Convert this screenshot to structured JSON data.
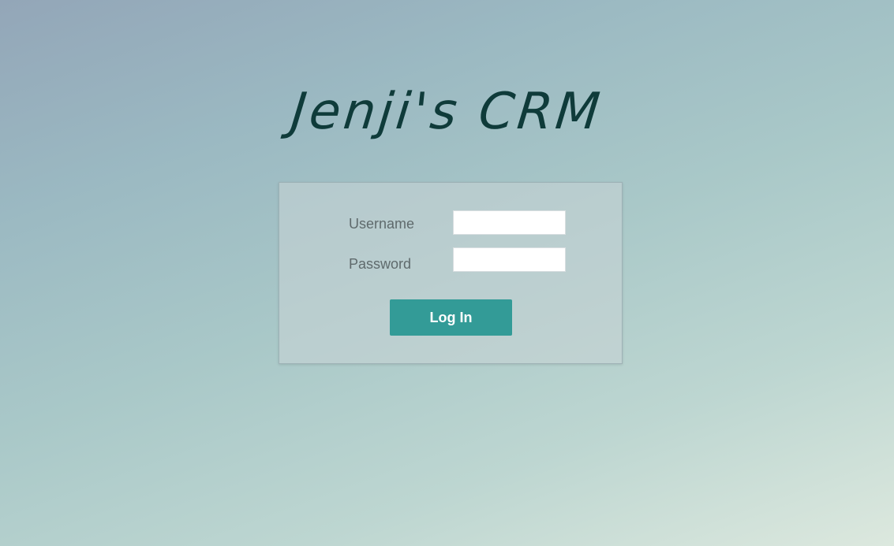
{
  "app": {
    "title": "Jenji's CRM"
  },
  "login_form": {
    "username_label": "Username",
    "username_value": "",
    "password_label": "Password",
    "password_value": "",
    "login_button_label": "Log In"
  },
  "colors": {
    "title": "#0f3b3a",
    "button": "#339b97",
    "label": "#5f6a6c"
  }
}
